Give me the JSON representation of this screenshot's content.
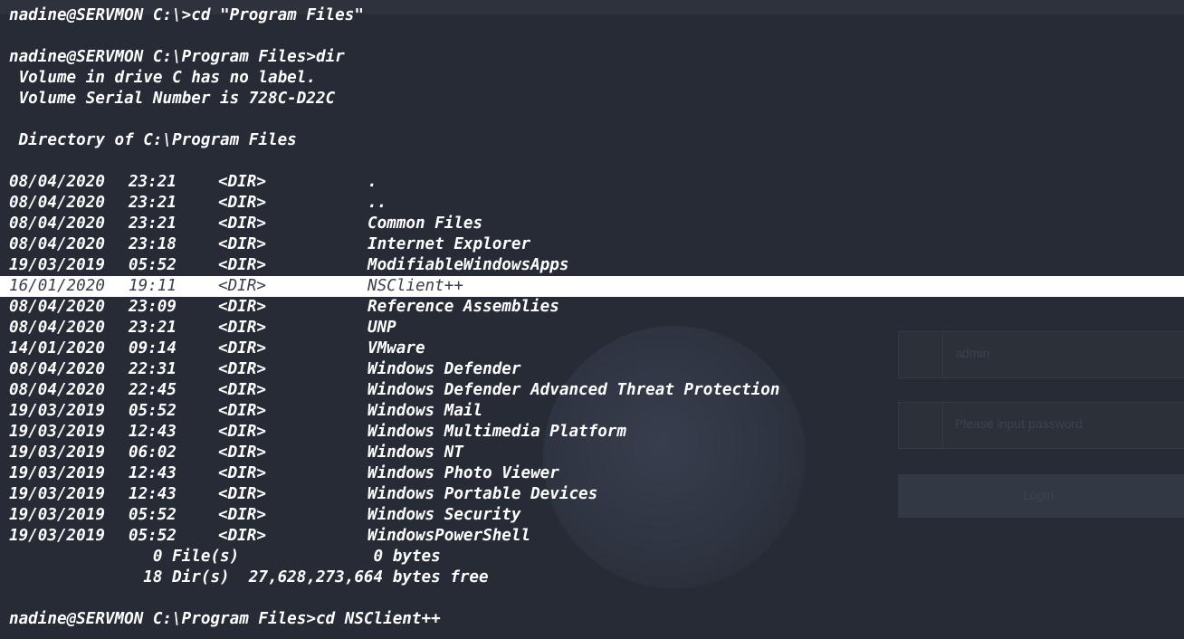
{
  "background_colors": {
    "terminal_bg": "#262b35",
    "text": "#ffffff",
    "highlight_bg": "#ffffff",
    "highlight_text": "#3a3f4a"
  },
  "commands": {
    "cd_program_files": "nadine@SERVMON C:\\>cd \"Program Files\"",
    "dir": "nadine@SERVMON C:\\Program Files>dir",
    "cd_nsclient": "nadine@SERVMON C:\\Program Files>cd NSClient++"
  },
  "volume": {
    "label_line": " Volume in drive C has no label.",
    "serial_line": " Volume Serial Number is 728C-D22C"
  },
  "directory_of": " Directory of C:\\Program Files",
  "entries": [
    {
      "date": "08/04/2020",
      "time": "23:21",
      "type": "<DIR>",
      "name": "."
    },
    {
      "date": "08/04/2020",
      "time": "23:21",
      "type": "<DIR>",
      "name": ".."
    },
    {
      "date": "08/04/2020",
      "time": "23:21",
      "type": "<DIR>",
      "name": "Common Files"
    },
    {
      "date": "08/04/2020",
      "time": "23:18",
      "type": "<DIR>",
      "name": "Internet Explorer"
    },
    {
      "date": "19/03/2019",
      "time": "05:52",
      "type": "<DIR>",
      "name": "ModifiableWindowsApps"
    },
    {
      "date": "16/01/2020",
      "time": "19:11",
      "type": "<DIR>",
      "name": "NSClient++"
    },
    {
      "date": "08/04/2020",
      "time": "23:09",
      "type": "<DIR>",
      "name": "Reference Assemblies"
    },
    {
      "date": "08/04/2020",
      "time": "23:21",
      "type": "<DIR>",
      "name": "UNP"
    },
    {
      "date": "14/01/2020",
      "time": "09:14",
      "type": "<DIR>",
      "name": "VMware"
    },
    {
      "date": "08/04/2020",
      "time": "22:31",
      "type": "<DIR>",
      "name": "Windows Defender"
    },
    {
      "date": "08/04/2020",
      "time": "22:45",
      "type": "<DIR>",
      "name": "Windows Defender Advanced Threat Protection"
    },
    {
      "date": "19/03/2019",
      "time": "05:52",
      "type": "<DIR>",
      "name": "Windows Mail"
    },
    {
      "date": "19/03/2019",
      "time": "12:43",
      "type": "<DIR>",
      "name": "Windows Multimedia Platform"
    },
    {
      "date": "19/03/2019",
      "time": "06:02",
      "type": "<DIR>",
      "name": "Windows NT"
    },
    {
      "date": "19/03/2019",
      "time": "12:43",
      "type": "<DIR>",
      "name": "Windows Photo Viewer"
    },
    {
      "date": "19/03/2019",
      "time": "12:43",
      "type": "<DIR>",
      "name": "Windows Portable Devices"
    },
    {
      "date": "19/03/2019",
      "time": "05:52",
      "type": "<DIR>",
      "name": "Windows Security"
    },
    {
      "date": "19/03/2019",
      "time": "05:52",
      "type": "<DIR>",
      "name": "WindowsPowerShell"
    }
  ],
  "highlighted_entry": "NSClient++",
  "summary": {
    "files_line": "               0 File(s)              0 bytes",
    "dirs_line": "              18 Dir(s)  27,628,273,664 bytes free"
  },
  "background_login": {
    "username": "admin",
    "password_placeholder": "Please input password",
    "button": "Login"
  }
}
